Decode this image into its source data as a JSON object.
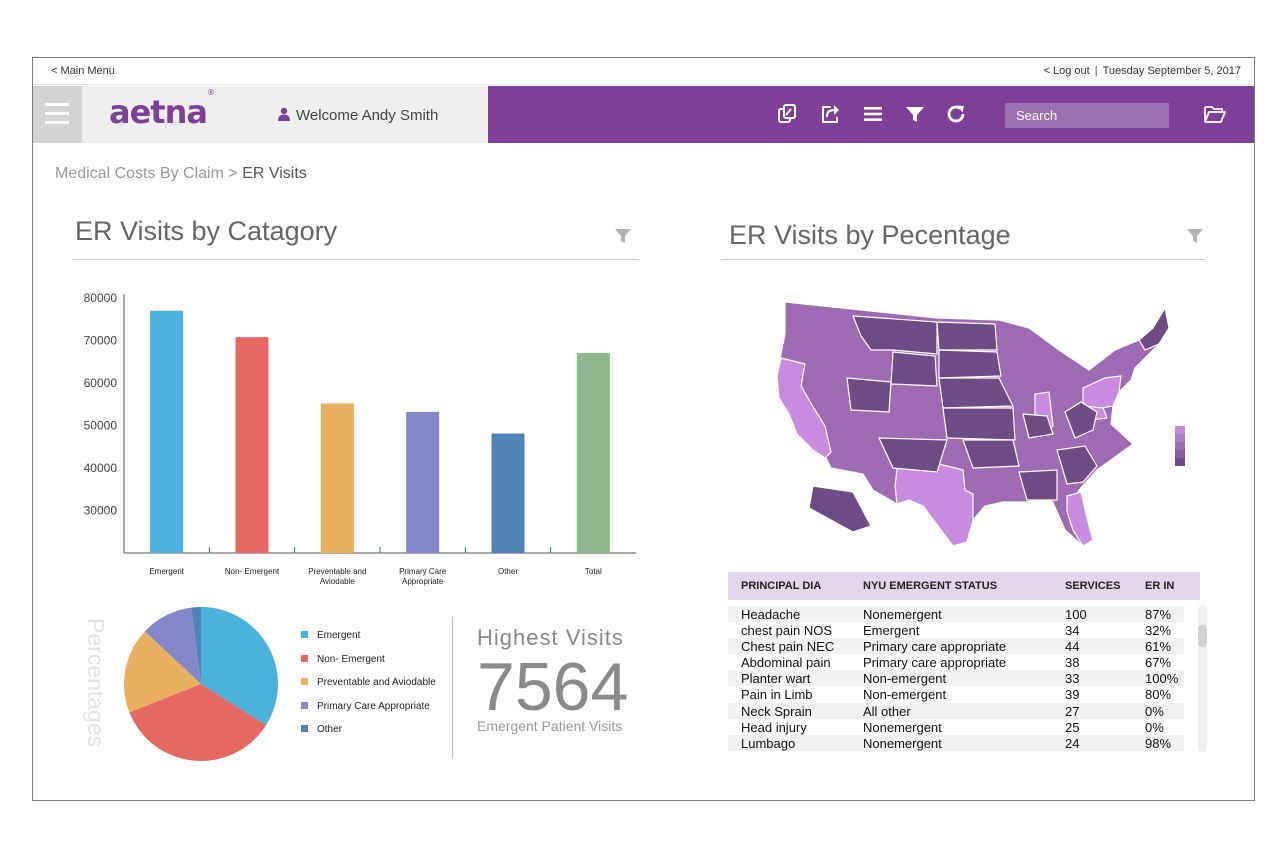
{
  "topbar": {
    "main_menu": "< Main Menu",
    "logout": "< Log out",
    "separator": "|",
    "date": "Tuesday September 5, 2017"
  },
  "header": {
    "logo": "aetna",
    "logo_mark": "®",
    "welcome": "Welcome Andy Smith",
    "icons": [
      "copy-icon",
      "share-icon",
      "list-icon",
      "filter-icon",
      "refresh-icon",
      "folder-open-icon"
    ],
    "search": {
      "placeholder": "Search",
      "value": ""
    },
    "brand_color": "#7d3f98"
  },
  "breadcrumb": {
    "parent": "Medical Costs By Claim",
    "separator": ">",
    "current": "ER Visits"
  },
  "left_panel": {
    "title": "ER Visits by Catagory",
    "vertical_label": "Percentages",
    "legend": [
      {
        "label": "Emergent",
        "color": "#4ab2db"
      },
      {
        "label": "Non- Emergent",
        "color": "#e66863"
      },
      {
        "label": "Preventable and  Aviodable",
        "color": "#e8b060"
      },
      {
        "label": "Primary Care Appropriate",
        "color": "#8488c8"
      },
      {
        "label": "Other",
        "color": "#4f82b6"
      }
    ],
    "highest": {
      "label": "Highest  Visits",
      "value": "7564",
      "sub": "Emergent Patient Visits"
    }
  },
  "chart_data": [
    {
      "type": "bar",
      "categories": [
        "Emergent",
        "Non- Emergent",
        "Preventable and Aviodable",
        "Primary Care Appropriate",
        "Other",
        "Total"
      ],
      "category_lines": [
        [
          "Emergent"
        ],
        [
          "Non- Emergent"
        ],
        [
          "Preventable and",
          "Aviodable"
        ],
        [
          "Primary Care",
          "Appropriate"
        ],
        [
          "Other"
        ],
        [
          "Total"
        ]
      ],
      "values": [
        77000,
        70800,
        55200,
        53200,
        48100,
        67100
      ],
      "colors": [
        "#4ab2db",
        "#e66863",
        "#e8b060",
        "#8488c8",
        "#4f82b6",
        "#8fb88c"
      ],
      "yticks": [
        30000,
        40000,
        50000,
        60000,
        70000,
        80000
      ],
      "ylim": [
        20000,
        80000
      ],
      "title": "",
      "xlabel": "",
      "ylabel": ""
    },
    {
      "type": "pie",
      "labels": [
        "Emergent",
        "Non- Emergent",
        "Preventable and  Aviodable",
        "Primary Care Appropriate",
        "Other"
      ],
      "values": [
        34,
        35,
        18,
        11,
        2
      ],
      "colors": [
        "#4ab2db",
        "#e66863",
        "#e8b060",
        "#8488c8",
        "#4f82b6"
      ]
    }
  ],
  "right_panel": {
    "title": "ER Visits by Pecentage",
    "map_colors": {
      "light": "#c98be0",
      "medium": "#9e6ab4",
      "dark": "#6f4b86"
    },
    "table": {
      "headers": [
        "PRINCIPAL DIA",
        "NYU EMERGENT STATUS",
        "SERVICES",
        "ER IN"
      ],
      "rows": [
        [
          "Headache",
          "Nonemergent",
          "100",
          "87%"
        ],
        [
          "chest pain NOS",
          "Emergent",
          "34",
          "32%"
        ],
        [
          "Chest pain NEC",
          "Primary care appropriate",
          "44",
          "61%"
        ],
        [
          "Abdominal pain",
          "Primary care appropriate",
          "38",
          "67%"
        ],
        [
          "Planter wart",
          "Non-emergent",
          "33",
          "100%"
        ],
        [
          "Pain in Limb",
          "Non-emergent",
          "39",
          "80%"
        ],
        [
          "Neck Sprain",
          "All other",
          "27",
          "0%"
        ],
        [
          "Head injury",
          "Nonemergent",
          "25",
          "0%"
        ],
        [
          "Lumbago",
          "Nonemergent",
          "24",
          "98%"
        ]
      ]
    }
  }
}
